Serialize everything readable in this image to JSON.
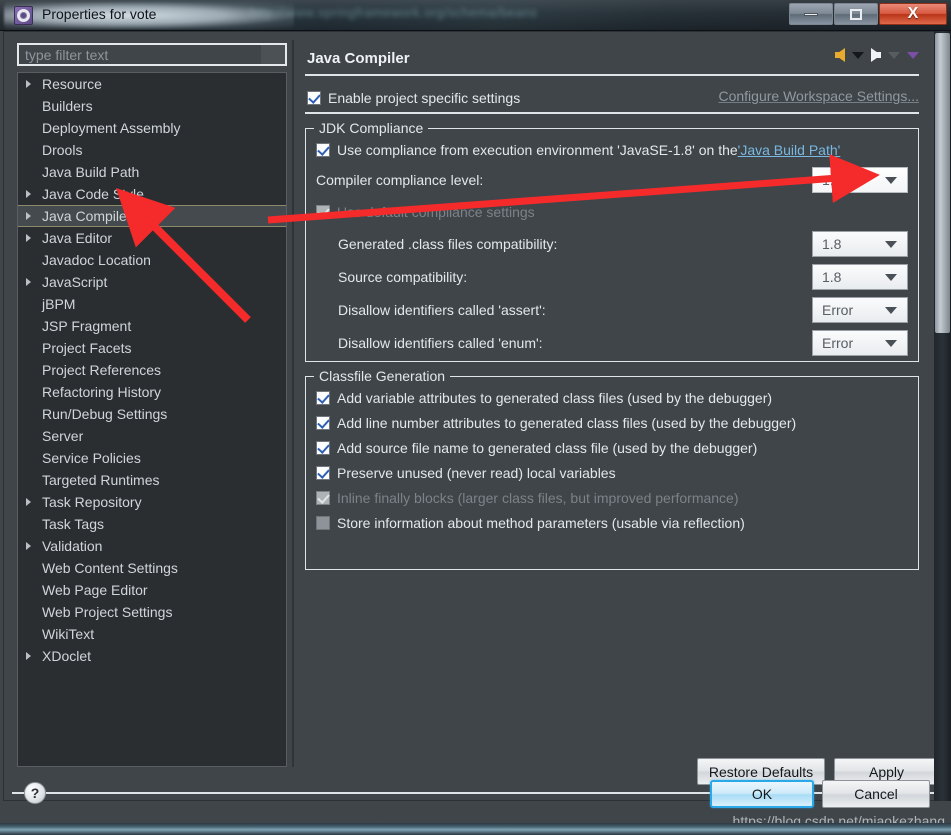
{
  "window": {
    "title": "Properties for vote",
    "icon": "gear-icon",
    "glass_text": "http://www.springframework.org/schema/beans",
    "minimize_label": "",
    "maximize_label": "",
    "close_label": "X"
  },
  "filter": {
    "placeholder": "type filter text",
    "value": ""
  },
  "tree": {
    "items": [
      {
        "label": "Resource",
        "expandable": true,
        "selected": false
      },
      {
        "label": "Builders",
        "expandable": false,
        "selected": false
      },
      {
        "label": "Deployment Assembly",
        "expandable": false,
        "selected": false
      },
      {
        "label": "Drools",
        "expandable": false,
        "selected": false
      },
      {
        "label": "Java Build Path",
        "expandable": false,
        "selected": false
      },
      {
        "label": "Java Code Style",
        "expandable": true,
        "selected": false
      },
      {
        "label": "Java Compiler",
        "expandable": true,
        "selected": true
      },
      {
        "label": "Java Editor",
        "expandable": true,
        "selected": false
      },
      {
        "label": "Javadoc Location",
        "expandable": false,
        "selected": false
      },
      {
        "label": "JavaScript",
        "expandable": true,
        "selected": false
      },
      {
        "label": "jBPM",
        "expandable": false,
        "selected": false
      },
      {
        "label": "JSP Fragment",
        "expandable": false,
        "selected": false
      },
      {
        "label": "Project Facets",
        "expandable": false,
        "selected": false
      },
      {
        "label": "Project References",
        "expandable": false,
        "selected": false
      },
      {
        "label": "Refactoring History",
        "expandable": false,
        "selected": false
      },
      {
        "label": "Run/Debug Settings",
        "expandable": false,
        "selected": false
      },
      {
        "label": "Server",
        "expandable": false,
        "selected": false
      },
      {
        "label": "Service Policies",
        "expandable": false,
        "selected": false
      },
      {
        "label": "Targeted Runtimes",
        "expandable": false,
        "selected": false
      },
      {
        "label": "Task Repository",
        "expandable": true,
        "selected": false
      },
      {
        "label": "Task Tags",
        "expandable": false,
        "selected": false
      },
      {
        "label": "Validation",
        "expandable": true,
        "selected": false
      },
      {
        "label": "Web Content Settings",
        "expandable": false,
        "selected": false
      },
      {
        "label": "Web Page Editor",
        "expandable": false,
        "selected": false
      },
      {
        "label": "Web Project Settings",
        "expandable": false,
        "selected": false
      },
      {
        "label": "WikiText",
        "expandable": false,
        "selected": false
      },
      {
        "label": "XDoclet",
        "expandable": true,
        "selected": false
      }
    ]
  },
  "page": {
    "title": "Java Compiler",
    "enable_project_specific": {
      "label": "Enable project specific settings",
      "checked": true
    },
    "configure_workspace_link": "Configure Workspace Settings...",
    "nav": {
      "back": "back-arrow",
      "back_menu": "chevron-down",
      "forward": "forward-arrow",
      "forward_menu": "chevron-down-disabled",
      "view_menu": "chevron-down-purple"
    }
  },
  "jdk_compliance": {
    "group_title": "JDK Compliance",
    "use_execution_env": {
      "prefix": "Use compliance from execution environment 'JavaSE-1.8' on the ",
      "link": "'Java Build Path'",
      "checked": true
    },
    "compliance_level": {
      "label": "Compiler compliance level:",
      "value": "1.8"
    },
    "use_default_compliance": {
      "label": "Use default compliance settings",
      "checked": true,
      "disabled": true
    },
    "rows": [
      {
        "label": "Generated .class files compatibility:",
        "value": "1.8"
      },
      {
        "label": "Source compatibility:",
        "value": "1.8"
      },
      {
        "label": "Disallow identifiers called 'assert':",
        "value": "Error"
      },
      {
        "label": "Disallow identifiers called 'enum':",
        "value": "Error"
      }
    ]
  },
  "classfile_generation": {
    "group_title": "Classfile Generation",
    "options": [
      {
        "label": "Add variable attributes to generated class files (used by the debugger)",
        "checked": true,
        "disabled": false
      },
      {
        "label": "Add line number attributes to generated class files (used by the debugger)",
        "checked": true,
        "disabled": false
      },
      {
        "label": "Add source file name to generated class file (used by the debugger)",
        "checked": true,
        "disabled": false
      },
      {
        "label": "Preserve unused (never read) local variables",
        "checked": true,
        "disabled": false
      },
      {
        "label": "Inline finally blocks (larger class files, but improved performance)",
        "checked": true,
        "disabled": true
      },
      {
        "label": "Store information about method parameters (usable via reflection)",
        "checked": false,
        "disabled": false
      }
    ]
  },
  "buttons": {
    "restore_defaults": "Restore Defaults",
    "apply": "Apply",
    "ok": "OK",
    "cancel": "Cancel",
    "help": "?"
  },
  "watermark": "https://blog.csdn.net/miaokezhang",
  "colors": {
    "accent_blue": "#2aa8e8",
    "link_blue": "#79b8e0",
    "annotation_red": "#f52a2a",
    "back_arrow_yellow": "#e8ab2e",
    "selection_border": "#8d8a6b"
  }
}
